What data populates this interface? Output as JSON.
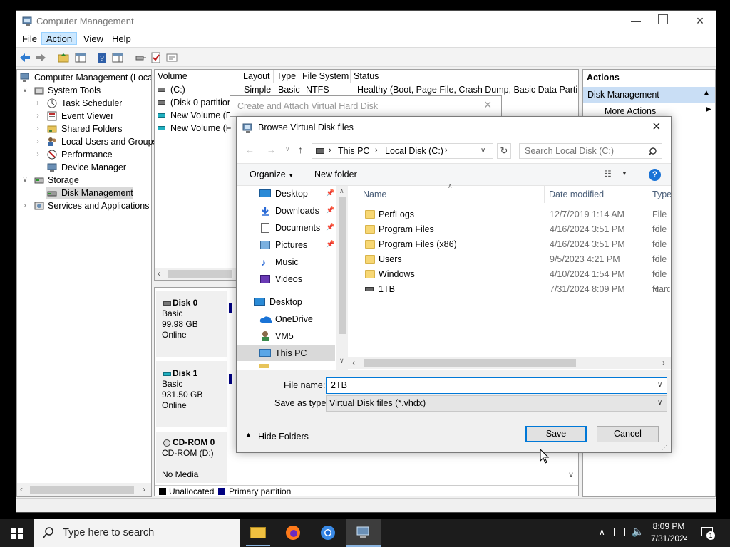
{
  "window": {
    "title": "Computer Management",
    "menu": [
      "File",
      "Action",
      "View",
      "Help"
    ]
  },
  "tree": {
    "root": "Computer Management (Local",
    "items": [
      {
        "label": "System Tools"
      },
      {
        "label": "Task Scheduler"
      },
      {
        "label": "Event Viewer"
      },
      {
        "label": "Shared Folders"
      },
      {
        "label": "Local Users and Groups"
      },
      {
        "label": "Performance"
      },
      {
        "label": "Device Manager"
      },
      {
        "label": "Storage"
      },
      {
        "label": "Disk Management"
      },
      {
        "label": "Services and Applications"
      }
    ]
  },
  "volumes": {
    "headers": [
      "Volume",
      "Layout",
      "Type",
      "File System",
      "Status"
    ],
    "rows": [
      {
        "volume": "(C:)",
        "layout": "Simple",
        "type": "Basic",
        "fs": "NTFS",
        "status": "Healthy (Boot, Page File, Crash Dump, Basic Data Partition)"
      },
      {
        "volume": "(Disk 0 partition"
      },
      {
        "volume": "New Volume (E:)"
      },
      {
        "volume": "New Volume (F:)"
      }
    ]
  },
  "disks": [
    {
      "name": "Disk 0",
      "type": "Basic",
      "size": "99.98 GB",
      "status": "Online"
    },
    {
      "name": "Disk 1",
      "type": "Basic",
      "size": "931.50 GB",
      "status": "Online"
    },
    {
      "name": "CD-ROM 0",
      "type": "CD-ROM (D:)",
      "size": "",
      "status": "No Media"
    }
  ],
  "legend": {
    "unallocated": "Unallocated",
    "primary": "Primary partition"
  },
  "actions": {
    "header": "Actions",
    "section": "Disk Management",
    "more": "More Actions"
  },
  "bg_dialog": {
    "title": "Create and Attach Virtual Hard Disk"
  },
  "browse": {
    "title": "Browse Virtual Disk files",
    "breadcrumb": [
      "This PC",
      "Local Disk (C:)"
    ],
    "search_placeholder": "Search Local Disk (C:)",
    "organize": "Organize",
    "new_folder": "New folder",
    "nav": {
      "quick": [
        {
          "label": "Desktop",
          "icon": "desktop-icon"
        },
        {
          "label": "Downloads",
          "icon": "downloads-icon"
        },
        {
          "label": "Documents",
          "icon": "documents-icon"
        },
        {
          "label": "Pictures",
          "icon": "pictures-icon"
        },
        {
          "label": "Music",
          "icon": "music-icon"
        },
        {
          "label": "Videos",
          "icon": "videos-icon"
        }
      ],
      "desktop": "Desktop",
      "onedrive": "OneDrive",
      "vm5": "VM5",
      "thispc": "This PC"
    },
    "columns": {
      "name": "Name",
      "date": "Date modified",
      "type": "Type"
    },
    "files": [
      {
        "name": "PerfLogs",
        "date": "12/7/2019 1:14 AM",
        "type": "File fo",
        "kind": "folder"
      },
      {
        "name": "Program Files",
        "date": "4/16/2024 3:51 PM",
        "type": "File fo",
        "kind": "folder"
      },
      {
        "name": "Program Files (x86)",
        "date": "4/16/2024 3:51 PM",
        "type": "File fo",
        "kind": "folder"
      },
      {
        "name": "Users",
        "date": "9/5/2023 4:21 PM",
        "type": "File fo",
        "kind": "folder"
      },
      {
        "name": "Windows",
        "date": "4/10/2024 1:54 PM",
        "type": "File fo",
        "kind": "folder"
      },
      {
        "name": "1TB",
        "date": "7/31/2024 8:09 PM",
        "type": "Hard",
        "kind": "drive"
      }
    ],
    "file_name_label": "File name:",
    "file_name_value": "2TB",
    "save_type_label": "Save as type:",
    "save_type_value": "Virtual Disk files (*.vhdx)",
    "hide_folders": "Hide Folders",
    "save": "Save",
    "cancel": "Cancel"
  },
  "taskbar": {
    "search_placeholder": "Type here to search",
    "time": "8:09 PM",
    "date": "7/31/2024",
    "notifications": "1"
  },
  "colors": {
    "accent": "#0078d7",
    "primary_partition": "#000080",
    "selection": "#cce8ff"
  }
}
